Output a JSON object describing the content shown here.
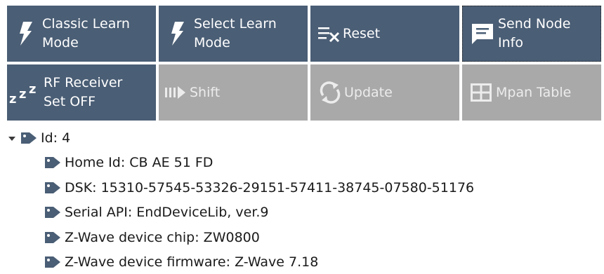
{
  "toolbar": {
    "buttons": [
      {
        "label": "Classic Learn\nMode",
        "icon": "lightning-bolt-icon",
        "state": "enabled"
      },
      {
        "label": "Select Learn\nMode",
        "icon": "lightning-bolt-icon",
        "state": "enabled"
      },
      {
        "label": "Reset",
        "icon": "clear-list-icon",
        "state": "enabled"
      },
      {
        "label": "Send Node\nInfo",
        "icon": "message-icon",
        "state": "enabled-focused"
      },
      {
        "label": "RF Receiver\nSet OFF",
        "icon": "sleep-zzz-icon",
        "state": "enabled"
      },
      {
        "label": "Shift",
        "icon": "shift-arrow-icon",
        "state": "disabled"
      },
      {
        "label": "Update",
        "icon": "refresh-icon",
        "state": "disabled"
      },
      {
        "label": "Mpan Table",
        "icon": "table-icon",
        "state": "disabled"
      }
    ]
  },
  "tree": {
    "root": {
      "label": "Id: 4",
      "expanded": true
    },
    "children": [
      {
        "label": "Home Id: CB AE 51 FD"
      },
      {
        "label": "DSK: 15310-57545-53326-29151-57411-38745-07580-51176"
      },
      {
        "label": "Serial API: EndDeviceLib, ver.9"
      },
      {
        "label": "Z-Wave device chip: ZW0800"
      },
      {
        "label": "Z-Wave device firmware: Z-Wave 7.18"
      }
    ]
  },
  "colors": {
    "button_active": "#4a5e75",
    "button_disabled": "#a9a9a9",
    "tag_icon": "#4a5e75",
    "text": "#1a1a1a"
  }
}
